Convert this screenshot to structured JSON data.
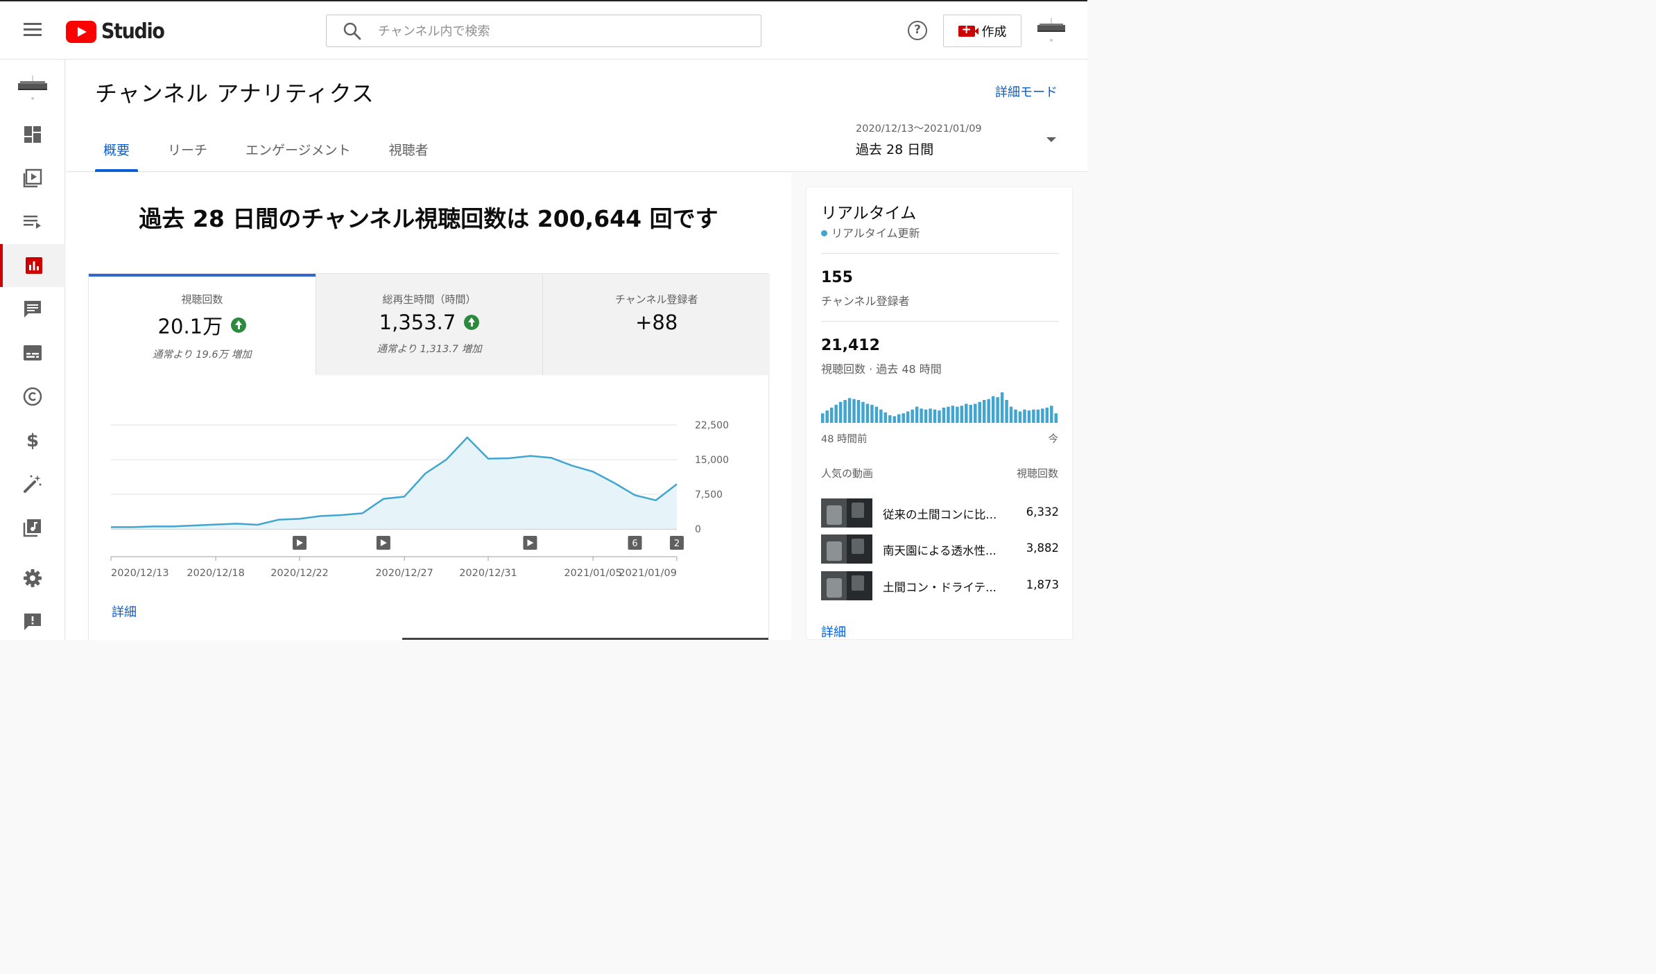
{
  "app": {
    "logo_text": "Studio"
  },
  "search": {
    "placeholder": "チャンネル内で検索"
  },
  "topbar": {
    "help_label": "?",
    "create_label": "作成"
  },
  "sidebar": {
    "items": [
      {
        "name": "dashboard-icon"
      },
      {
        "name": "content-icon"
      },
      {
        "name": "playlists-icon"
      },
      {
        "name": "analytics-icon",
        "active": true
      },
      {
        "name": "comments-icon"
      },
      {
        "name": "subtitles-icon"
      },
      {
        "name": "copyright-icon"
      },
      {
        "name": "monetization-icon"
      },
      {
        "name": "customization-icon"
      },
      {
        "name": "audio-library-icon"
      },
      {
        "name": "settings-icon"
      },
      {
        "name": "feedback-icon"
      }
    ]
  },
  "page": {
    "title": "チャンネル アナリティクス",
    "detail_mode": "詳細モード"
  },
  "tabs": [
    {
      "label": "概要",
      "active": true
    },
    {
      "label": "リーチ"
    },
    {
      "label": "エンゲージメント"
    },
    {
      "label": "視聴者"
    }
  ],
  "date_range": {
    "range": "2020/12/13〜2021/01/09",
    "label": "過去 28 日間"
  },
  "headline": "過去 28 日間のチャンネル視聴回数は 200,644 回です",
  "metrics": [
    {
      "label": "視聴回数",
      "value": "20.1万",
      "up": true,
      "sub": "通常より 19.6万 増加"
    },
    {
      "label": "総再生時間（時間）",
      "value": "1,353.7",
      "up": true,
      "sub": "通常より 1,313.7 増加"
    },
    {
      "label": "チャンネル登録者",
      "value": "+88",
      "up": false,
      "sub": ""
    }
  ],
  "chart_data": {
    "type": "area",
    "x": [
      "2020/12/13",
      "2020/12/14",
      "2020/12/15",
      "2020/12/16",
      "2020/12/17",
      "2020/12/18",
      "2020/12/19",
      "2020/12/20",
      "2020/12/21",
      "2020/12/22",
      "2020/12/23",
      "2020/12/24",
      "2020/12/25",
      "2020/12/26",
      "2020/12/27",
      "2020/12/28",
      "2020/12/29",
      "2020/12/30",
      "2020/12/31",
      "2021/01/01",
      "2021/01/02",
      "2021/01/03",
      "2021/01/04",
      "2021/01/05",
      "2021/01/06",
      "2021/01/07",
      "2021/01/08",
      "2021/01/09"
    ],
    "values": [
      400,
      400,
      550,
      550,
      750,
      950,
      1150,
      900,
      2000,
      2200,
      2800,
      3000,
      3400,
      6500,
      7000,
      12000,
      15000,
      19800,
      15200,
      15300,
      15800,
      15400,
      13700,
      12400,
      10000,
      7300,
      6200,
      9700
    ],
    "yticks": [
      0,
      7500,
      15000,
      22500
    ],
    "ytick_labels": [
      "0",
      "7,500",
      "15,000",
      "22,500"
    ],
    "ylim": [
      0,
      22500
    ],
    "xtick_labels": [
      "2020/12/13",
      "2020/12/18",
      "2020/12/22",
      "2020/12/27",
      "2020/12/31",
      "2021/01/05",
      "2021/01/09"
    ],
    "xtick_dates": [
      "2020/12/13",
      "2020/12/18",
      "2020/12/22",
      "2020/12/27",
      "2020/12/31",
      "2021/01/05",
      "2021/01/09"
    ],
    "markers": [
      {
        "date": "2020/12/22",
        "kind": "video"
      },
      {
        "date": "2020/12/26",
        "kind": "video"
      },
      {
        "date": "2021/01/02",
        "kind": "video"
      },
      {
        "date": "2021/01/07",
        "kind": "count",
        "label": "6"
      },
      {
        "date": "2021/01/09",
        "kind": "count",
        "label": "2"
      }
    ],
    "colors": {
      "line": "#41a5d0",
      "fill": "#e6f3f9",
      "grid": "#e0e0e0"
    }
  },
  "chart_detail": "詳細",
  "realtime": {
    "title": "リアルタイム",
    "subtitle": "リアルタイム更新",
    "subscribers": "155",
    "subscribers_label": "チャンネル登録者",
    "views": "21,412",
    "views_label": "視聴回数 · 過去 48 時間",
    "bars": [
      10,
      13,
      16,
      19,
      22,
      24,
      26,
      25,
      24,
      22,
      20,
      19,
      17,
      14,
      11,
      8,
      7,
      9,
      10,
      12,
      14,
      17,
      15,
      14,
      15,
      14,
      13,
      16,
      17,
      18,
      17,
      18,
      20,
      19,
      20,
      22,
      24,
      25,
      28,
      27,
      32,
      24,
      17,
      14,
      12,
      14,
      13,
      14,
      14,
      15,
      16,
      18,
      10
    ],
    "axis_left": "48 時間前",
    "axis_right": "今",
    "top_videos_label": "人気の動画",
    "views_col_label": "視聴回数",
    "videos": [
      {
        "title": "従来の土間コンに比...",
        "views": "6,332"
      },
      {
        "title": "南天園による透水性...",
        "views": "3,882"
      },
      {
        "title": "土間コン・ドライテ...",
        "views": "1,873"
      }
    ],
    "detail": "詳細",
    "bar_color": "#41a5d0"
  }
}
